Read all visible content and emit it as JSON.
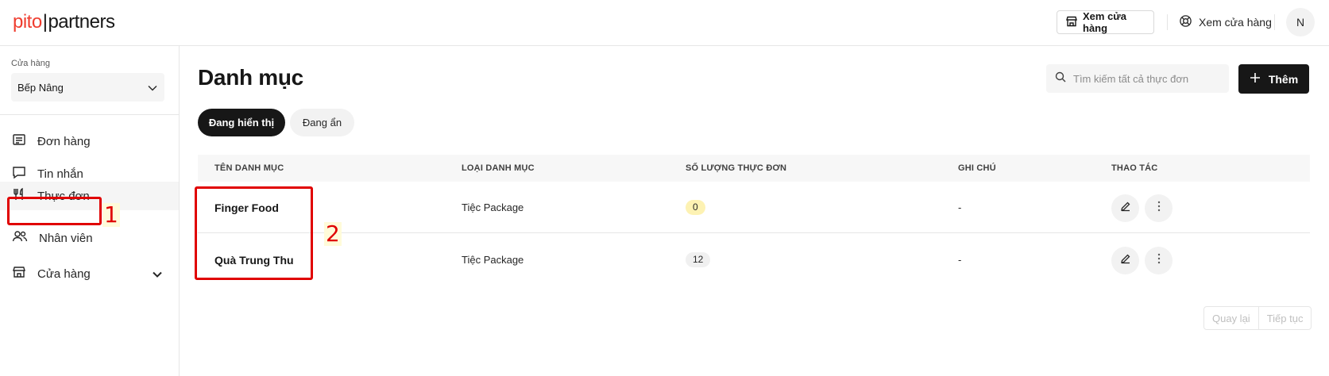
{
  "brand": {
    "logo_left": "pito",
    "logo_right": "partners"
  },
  "header": {
    "store_button_label": "Xem cửa hàng",
    "support_label": "Xem cửa hàng",
    "avatar_initial": "N"
  },
  "sidebar": {
    "store_label": "Cửa hàng",
    "store_value": "Bếp Nâng",
    "items": [
      {
        "label": "Đơn hàng",
        "icon": "receipt-icon"
      },
      {
        "label": "Tin nhắn",
        "icon": "message-icon"
      },
      {
        "label": "Thực đơn",
        "icon": "utensils-icon",
        "active": true
      },
      {
        "label": "Nhân viên",
        "icon": "users-icon"
      },
      {
        "label": "Cửa hàng",
        "icon": "store-icon",
        "has_chevron": true
      }
    ]
  },
  "main": {
    "title": "Danh mục",
    "search_placeholder": "Tìm kiếm tất cả thực đơn",
    "add_label": "Thêm",
    "tabs": [
      {
        "label": "Đang hiển thị",
        "active": true
      },
      {
        "label": "Đang ẩn",
        "active": false
      }
    ],
    "table": {
      "headers": [
        "TÊN DANH MỤC",
        "LOẠI DANH MỤC",
        "SỐ LƯỢNG THỰC ĐƠN",
        "GHI CHÚ",
        "THAO TÁC"
      ],
      "rows": [
        {
          "name": "Finger Food",
          "type": "Tiệc Package",
          "count": "0",
          "note": "-"
        },
        {
          "name": "Quà Trung Thu",
          "type": "Tiệc Package",
          "count": "12",
          "note": "-"
        }
      ]
    },
    "pagination": {
      "prev": "Quay lại",
      "next": "Tiếp tục"
    }
  },
  "annotations": [
    {
      "label": "1",
      "color": "#e00000"
    },
    {
      "label": "2",
      "color": "#e00000"
    }
  ],
  "colors": {
    "brand_red": "#ef3d2f",
    "primary_dark": "#171717",
    "annotation_red": "#e00000",
    "count_badge_yellow": "#fdf2b3"
  }
}
